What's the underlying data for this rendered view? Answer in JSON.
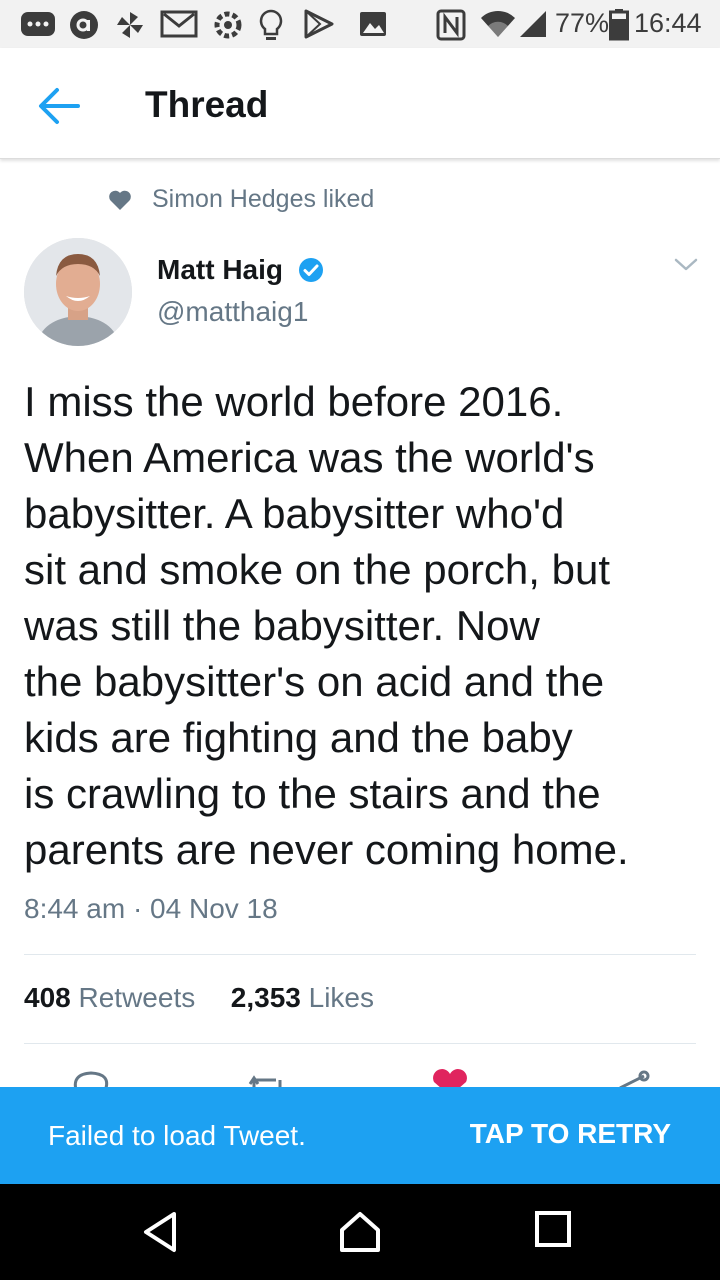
{
  "status_bar": {
    "battery": "77%",
    "time": "16:44",
    "icons": [
      "more-icon",
      "at-icon",
      "pinwheel-icon",
      "gmail-icon",
      "settings-icon",
      "lightbulb-icon",
      "play-store-icon",
      "image-icon",
      "nfc-icon",
      "wifi-icon",
      "signal-icon",
      "battery-icon"
    ]
  },
  "header": {
    "title": "Thread",
    "back_icon": "arrow-left-icon"
  },
  "social_context": {
    "text": "Simon Hedges liked",
    "icon": "heart-icon"
  },
  "author": {
    "name": "Matt Haig",
    "handle": "@matthaig1",
    "verified": true
  },
  "tweet": {
    "lines": [
      "I miss the world before 2016.",
      "When America was the world's",
      "babysitter. A babysitter who'd",
      "sit and smoke on the porch, but",
      "was still the babysitter. Now",
      "the babysitter's on acid and the",
      "kids are fighting and the baby",
      "is crawling to the stairs and the",
      "parents are never coming home."
    ],
    "timestamp": "8:44 am · 04 Nov 18"
  },
  "stats": {
    "retweets_count": "408",
    "retweets_label": "Retweets",
    "likes_count": "2,353",
    "likes_label": "Likes"
  },
  "actions": [
    "reply-icon",
    "retweet-icon",
    "like-icon",
    "share-icon"
  ],
  "snackbar": {
    "message": "Failed to load Tweet.",
    "action": "TAP TO RETRY"
  },
  "nav_bar": [
    "back-icon",
    "home-icon",
    "recents-icon"
  ],
  "colors": {
    "accent": "#1da1f2",
    "muted": "#657786",
    "like": "#e0245e"
  }
}
